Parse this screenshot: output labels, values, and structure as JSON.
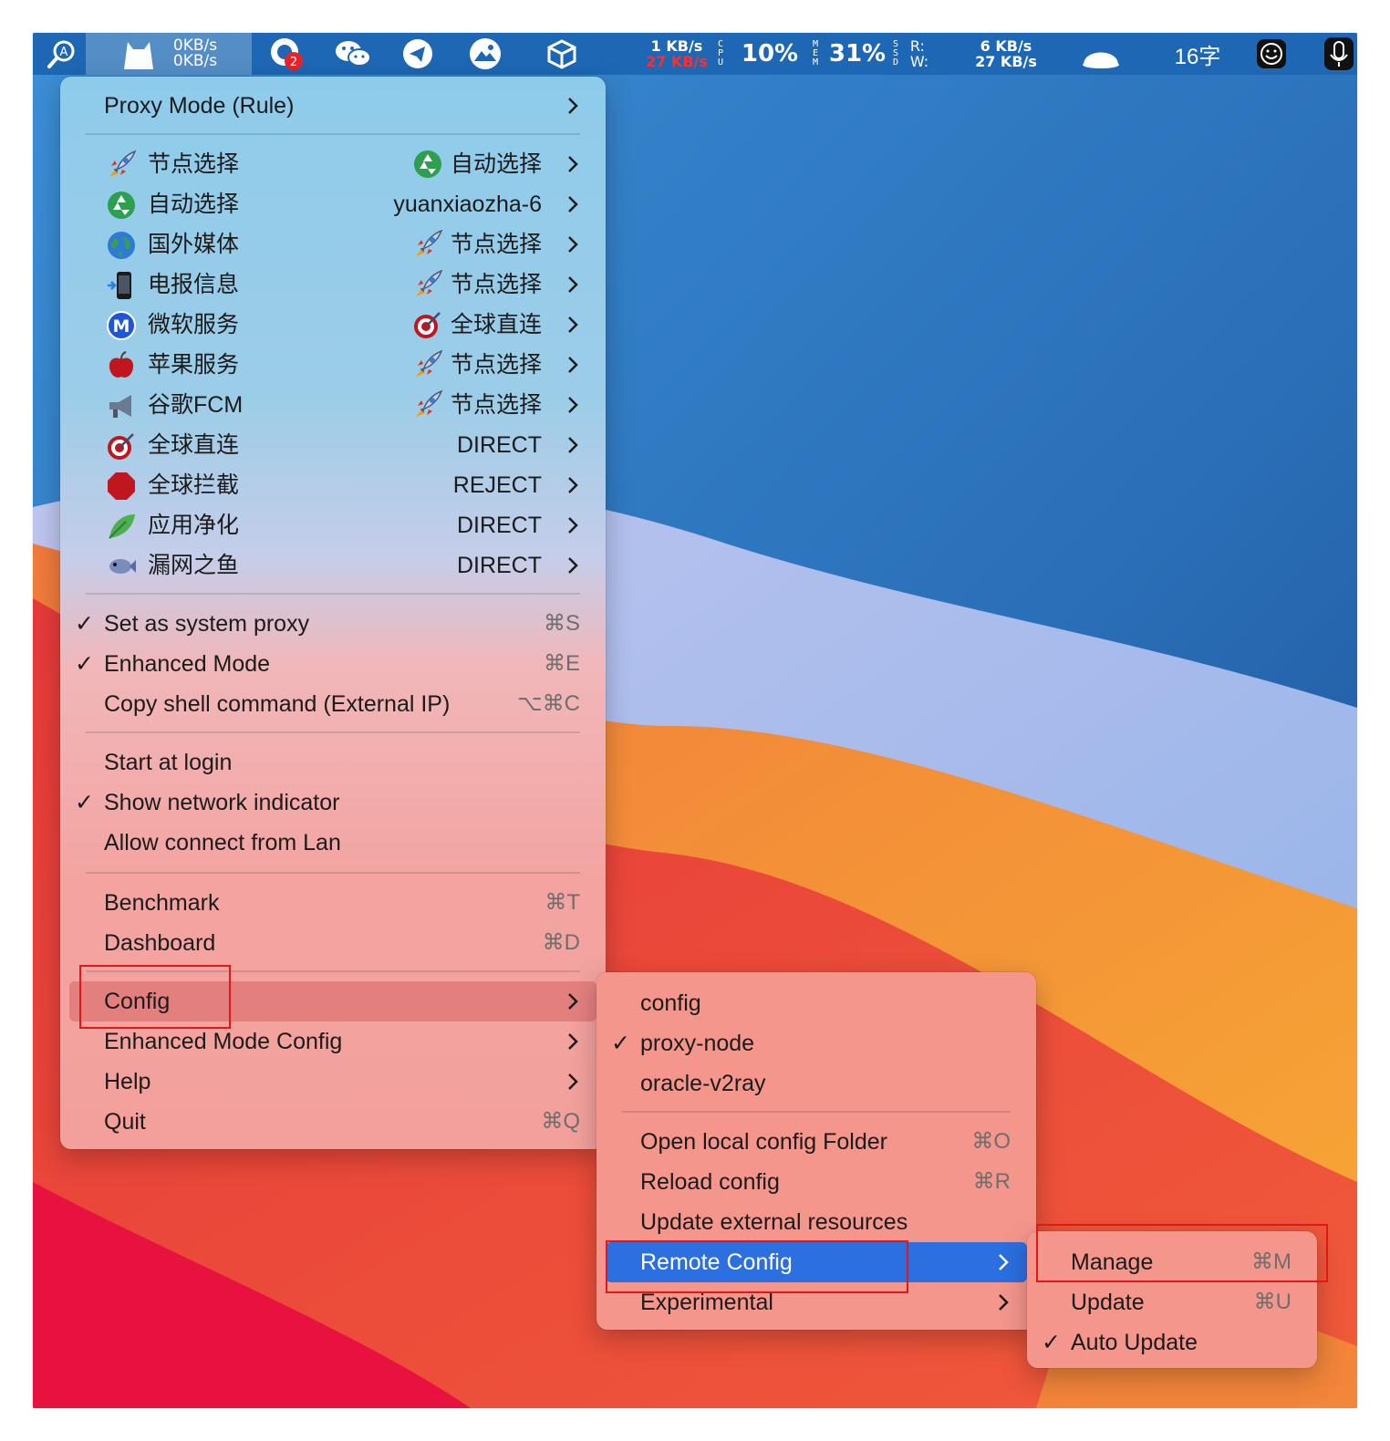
{
  "menubar": {
    "net_up": "0KB/s",
    "net_down": "0KB/s",
    "badge": "2",
    "kbs_up": "1 KB/s",
    "kbs_down": "27 KB/s",
    "cpu_label": "CPU",
    "cpu": "10%",
    "mem_label": "MEM",
    "mem": "31%",
    "ssd_label": "SSD",
    "rw": "R:\nW:",
    "disk_up": "6 KB/s",
    "disk_down": "27 KB/s",
    "words": "16字",
    "icons": [
      "search-icon",
      "clash-cat-icon",
      "notification-icon",
      "wechat-icon",
      "telegram-icon",
      "mountain-icon",
      "box-icon",
      "cloud-icon",
      "smiley-icon",
      "microphone-icon"
    ]
  },
  "main_menu": {
    "proxy_mode": "Proxy Mode (Rule)",
    "groups": [
      {
        "name": "节点选择",
        "icon": "rocket",
        "value": "自动选择",
        "value_icon": "recycle"
      },
      {
        "name": "自动选择",
        "icon": "recycle",
        "value": "yuanxiaozha-6",
        "value_icon": ""
      },
      {
        "name": "国外媒体",
        "icon": "globe",
        "value": "节点选择",
        "value_icon": "rocket"
      },
      {
        "name": "电报信息",
        "icon": "phone",
        "value": "节点选择",
        "value_icon": "rocket"
      },
      {
        "name": "微软服务",
        "icon": "metro",
        "value": "全球直连",
        "value_icon": "target"
      },
      {
        "name": "苹果服务",
        "icon": "apple",
        "value": "节点选择",
        "value_icon": "rocket"
      },
      {
        "name": "谷歌FCM",
        "icon": "megaphone",
        "value": "节点选择",
        "value_icon": "rocket"
      },
      {
        "name": "全球直连",
        "icon": "target",
        "value": "DIRECT",
        "value_icon": ""
      },
      {
        "name": "全球拦截",
        "icon": "stop",
        "value": "REJECT",
        "value_icon": ""
      },
      {
        "name": "应用净化",
        "icon": "leaf",
        "value": "DIRECT",
        "value_icon": ""
      },
      {
        "name": "漏网之鱼",
        "icon": "fish",
        "value": "DIRECT",
        "value_icon": ""
      }
    ],
    "system_proxy": "Set as system proxy",
    "system_proxy_sc": "⌘S",
    "enhanced_mode": "Enhanced Mode",
    "enhanced_mode_sc": "⌘E",
    "copy_shell": "Copy shell command (External IP)",
    "copy_shell_sc": "⌥⌘C",
    "start_login": "Start at login",
    "show_indicator": "Show network indicator",
    "allow_lan": "Allow connect from Lan",
    "benchmark": "Benchmark",
    "benchmark_sc": "⌘T",
    "dashboard": "Dashboard",
    "dashboard_sc": "⌘D",
    "config": "Config",
    "enhanced_config": "Enhanced Mode Config",
    "help": "Help",
    "quit": "Quit",
    "quit_sc": "⌘Q"
  },
  "config_menu": {
    "items": [
      "config",
      "proxy-node",
      "oracle-v2ray"
    ],
    "checked": "proxy-node",
    "open_folder": "Open local config Folder",
    "open_folder_sc": "⌘O",
    "reload": "Reload config",
    "reload_sc": "⌘R",
    "update_ext": "Update external resources",
    "remote": "Remote Config",
    "experimental": "Experimental"
  },
  "remote_menu": {
    "manage": "Manage",
    "manage_sc": "⌘M",
    "update": "Update",
    "update_sc": "⌘U",
    "auto_update": "Auto Update"
  },
  "colors": {
    "menubar": "#1d67b4",
    "highlight": "#2b6fe0",
    "annotation": "#e01818"
  }
}
